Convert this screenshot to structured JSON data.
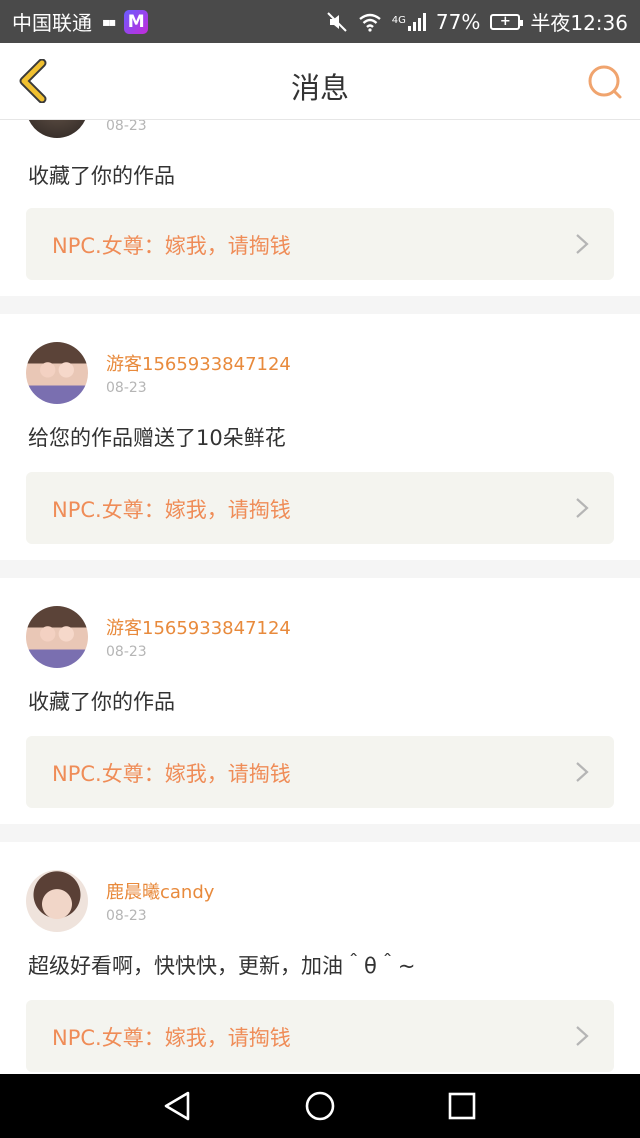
{
  "status_bar": {
    "carrier": "中国联通",
    "network": "4G",
    "battery": "77%",
    "time": "半夜12:36"
  },
  "header": {
    "title": "消息",
    "back_icon": "chevron-left-icon",
    "search_icon": "search-icon"
  },
  "messages": [
    {
      "user": "",
      "date": "08-23",
      "text": "收藏了你的作品",
      "quote": "NPC.女尊：嫁我，请掏钱"
    },
    {
      "user": "游客15659338471​24",
      "date": "08-23",
      "text": "给您的作品赠送了10朵鲜花",
      "quote": "NPC.女尊：嫁我，请掏钱"
    },
    {
      "user": "游客15659338471​24",
      "date": "08-23",
      "text": "收藏了你的作品",
      "quote": "NPC.女尊：嫁我，请掏钱"
    },
    {
      "user": "鹿晨曦candy",
      "date": "08-23",
      "text": "超级好看啊，快快快，更新，加油＾θ＾~",
      "quote": "NPC.女尊：嫁我，请掏钱"
    }
  ],
  "colors": {
    "accent": "#ef8c57",
    "username": "#e88a3c",
    "back_arrow": "#f0c030"
  }
}
